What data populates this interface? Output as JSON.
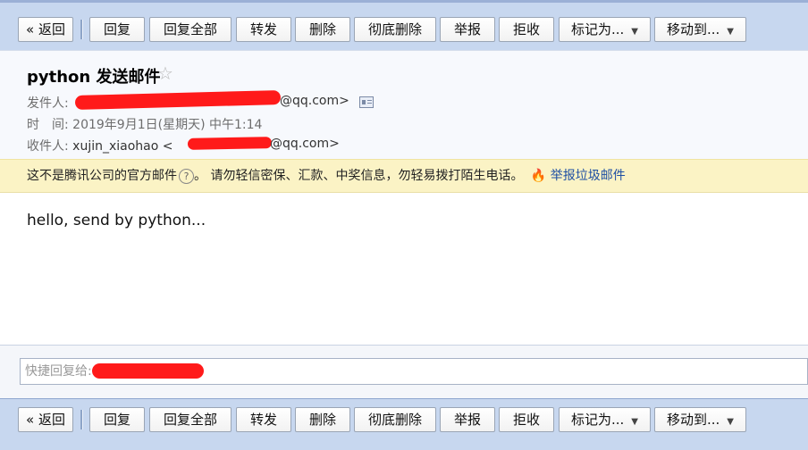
{
  "toolbar": {
    "back": "« 返回",
    "reply": "回复",
    "reply_all": "回复全部",
    "forward": "转发",
    "delete": "删除",
    "delete_permanently": "彻底删除",
    "report": "举报",
    "reject": "拒收",
    "mark_as": "标记为...",
    "move_to": "移动到...",
    "dropdown_caret": "▼"
  },
  "email": {
    "subject": "python 发送邮件",
    "star": "☆",
    "from_label": "发件人:",
    "from_value_suffix": "@qq.com>",
    "time_label": "时　间:",
    "time_value": "2019年9月1日(星期天) 中午1:14",
    "to_label": "收件人:",
    "to_name": "xujin_xiaohao <",
    "to_value_suffix": "@qq.com>",
    "body": "hello, send by python..."
  },
  "warning": {
    "text": "这不是腾讯公司的官方邮件",
    "help": "?",
    "advice": "。 请勿轻信密保、汇款、中奖信息，勿轻易拨打陌生电话。",
    "report_icon": "🔥",
    "report_link": "举报垃圾邮件"
  },
  "quick_reply": {
    "placeholder": "快捷回复给:"
  },
  "colors": {
    "toolbar_bg": "#c7d7ef",
    "warning_bg": "#fbf3c5",
    "redaction": "#ff1a1a",
    "link": "#1e4fa3"
  }
}
